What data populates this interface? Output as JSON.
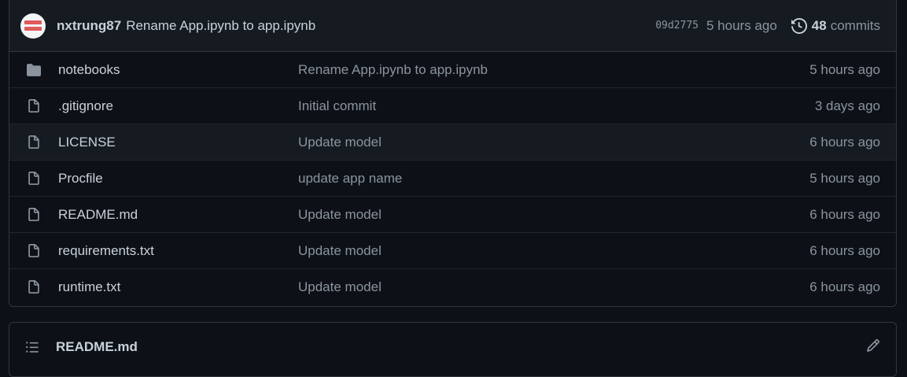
{
  "commit": {
    "author": "nxtrung87",
    "message": "Rename App.ipynb to app.ipynb",
    "sha": "09d2775",
    "time": "5 hours ago",
    "commit_count": "48",
    "commits_label": "commits"
  },
  "files": [
    {
      "type": "folder",
      "name": "notebooks",
      "message": "Rename App.ipynb to app.ipynb",
      "time": "5 hours ago"
    },
    {
      "type": "file",
      "name": ".gitignore",
      "message": "Initial commit",
      "time": "3 days ago"
    },
    {
      "type": "file",
      "name": "LICENSE",
      "message": "Update model",
      "time": "6 hours ago"
    },
    {
      "type": "file",
      "name": "Procfile",
      "message": "update app name",
      "time": "5 hours ago"
    },
    {
      "type": "file",
      "name": "README.md",
      "message": "Update model",
      "time": "6 hours ago"
    },
    {
      "type": "file",
      "name": "requirements.txt",
      "message": "Update model",
      "time": "6 hours ago"
    },
    {
      "type": "file",
      "name": "runtime.txt",
      "message": "Update model",
      "time": "6 hours ago"
    }
  ],
  "readme": {
    "title": "README.md"
  },
  "icons": {
    "folder": "folder-icon",
    "file": "file-icon",
    "history": "history-icon",
    "list": "list-icon",
    "edit": "pencil-icon"
  },
  "colors": {
    "background": "#0d1117",
    "header": "#161b22",
    "border": "#30363d",
    "text": "#c9d1d9",
    "muted": "#8b949e"
  }
}
